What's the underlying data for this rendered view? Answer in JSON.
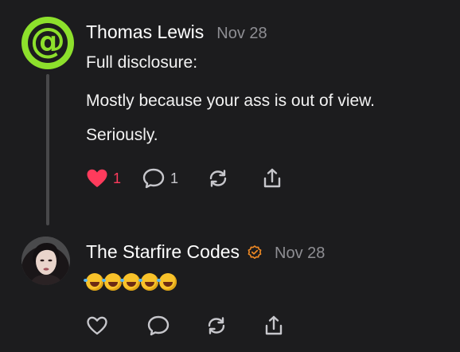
{
  "posts": [
    {
      "author": "Thomas Lewis",
      "date": "Nov 28",
      "avatar_glyph": "@",
      "avatar_color": "#8de02c",
      "lines": [
        "Full disclosure:",
        "Mostly because your ass is out of view.",
        "Seriously."
      ],
      "likes": "1",
      "liked": true,
      "replies": "1",
      "icons": [
        "heart-filled-icon",
        "comment-icon",
        "repost-icon",
        "share-icon"
      ]
    },
    {
      "author": "The Starfire Codes",
      "date": "Nov 28",
      "verified": true,
      "emoji": "🤣🤣🤣🤣🤣",
      "icons": [
        "heart-outline-icon",
        "comment-icon",
        "repost-icon",
        "share-icon"
      ]
    }
  ],
  "colors": {
    "background": "#1c1c1e",
    "like_red": "#ff3b5c",
    "verified_orange": "#f08a24",
    "muted": "#8e8e93"
  }
}
